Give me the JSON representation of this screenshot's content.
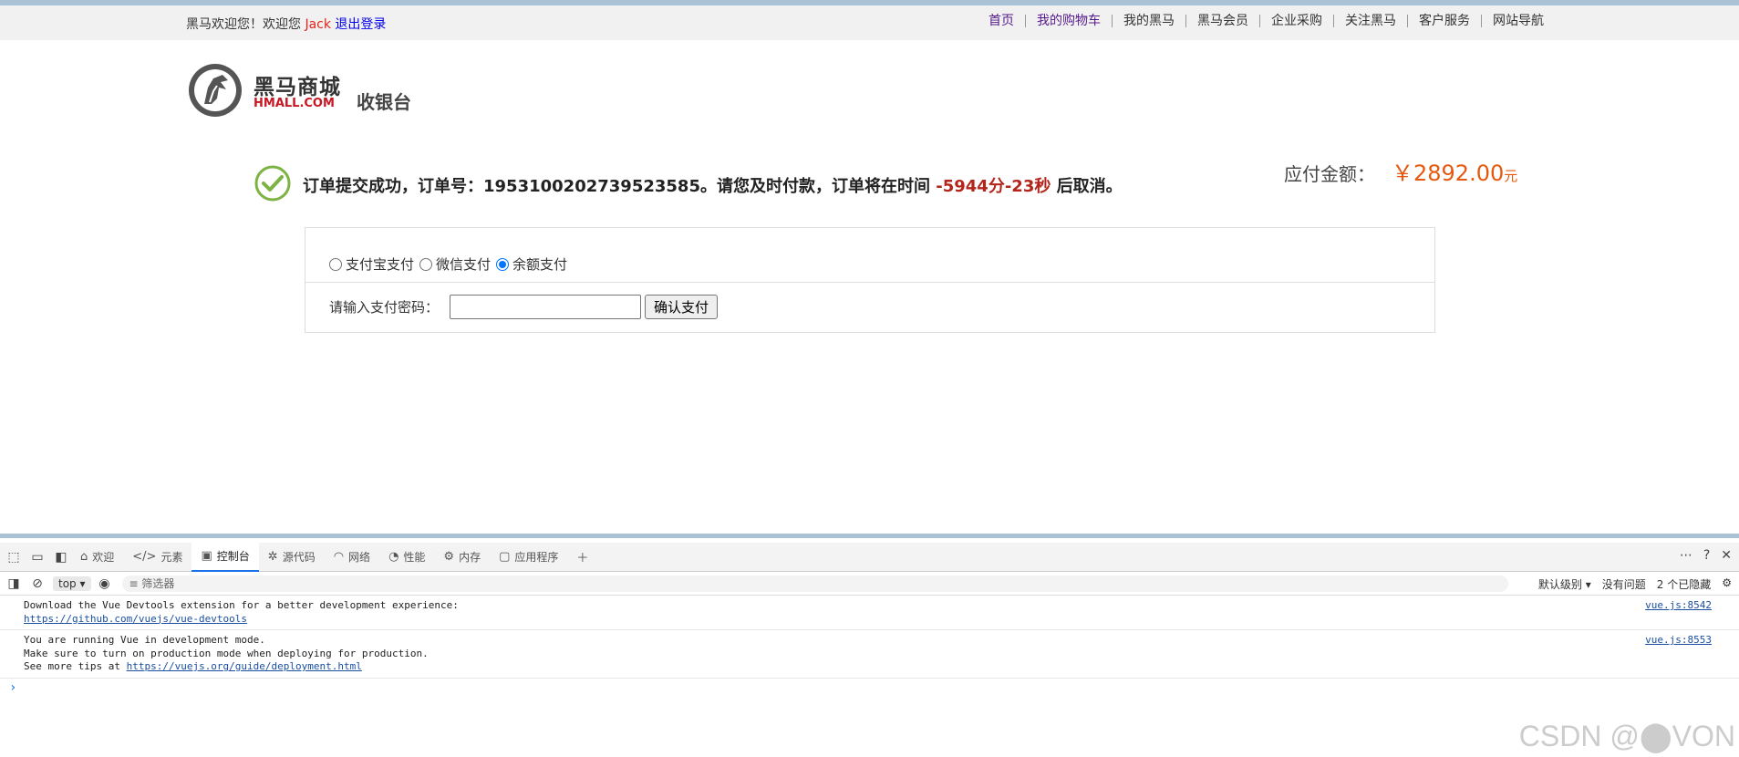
{
  "topbar": {
    "welcome_prefix": "黑马欢迎您！欢迎您",
    "username": "Jack",
    "logout": "退出登录",
    "nav": [
      "首页",
      "我的购物车",
      "我的黑马",
      "黑马会员",
      "企业采购",
      "关注黑马",
      "客户服务",
      "网站导航"
    ]
  },
  "header": {
    "logo_cn": "黑马商城",
    "logo_en": "HMALL.COM",
    "page_title": "收银台"
  },
  "order": {
    "msg_prefix": "订单提交成功，订单号：1953100202739523585。请您及时付款，订单将在时间",
    "time_left": "-5944分-23秒",
    "msg_suffix": "后取消。",
    "amount_label": "应付金额：",
    "amount_value": "￥2892.00",
    "amount_unit": "元"
  },
  "payment": {
    "methods": [
      {
        "label": "支付宝支付",
        "checked": false
      },
      {
        "label": "微信支付",
        "checked": false
      },
      {
        "label": "余额支付",
        "checked": true
      }
    ],
    "password_label": "请输入支付密码：",
    "password_value": "",
    "confirm": "确认支付"
  },
  "devtools": {
    "tabs": [
      {
        "label": "欢迎",
        "icon": "home-icon"
      },
      {
        "label": "元素",
        "icon": "code-icon"
      },
      {
        "label": "控制台",
        "icon": "console-icon"
      },
      {
        "label": "源代码",
        "icon": "bug-icon"
      },
      {
        "label": "网络",
        "icon": "wifi-icon"
      },
      {
        "label": "性能",
        "icon": "gauge-icon"
      },
      {
        "label": "内存",
        "icon": "gear-icon"
      },
      {
        "label": "应用程序",
        "icon": "app-icon"
      }
    ],
    "active_tab": "控制台",
    "context": "top",
    "filter_placeholder": "筛选器",
    "level": "默认级别",
    "issues": "没有问题",
    "hidden": "2 个已隐藏",
    "logs": [
      {
        "line1": "Download the Vue Devtools extension for a better development experience:",
        "link": "https://github.com/vuejs/vue-devtools",
        "src": "vue.js:8542"
      },
      {
        "line1": "You are running Vue in development mode.",
        "line2": "Make sure to turn on production mode when deploying for production.",
        "line3_prefix": "See more tips at ",
        "link": "https://vuejs.org/guide/deployment.html",
        "src": "vue.js:8553"
      }
    ]
  },
  "watermark": "CSDN @⬤VON"
}
